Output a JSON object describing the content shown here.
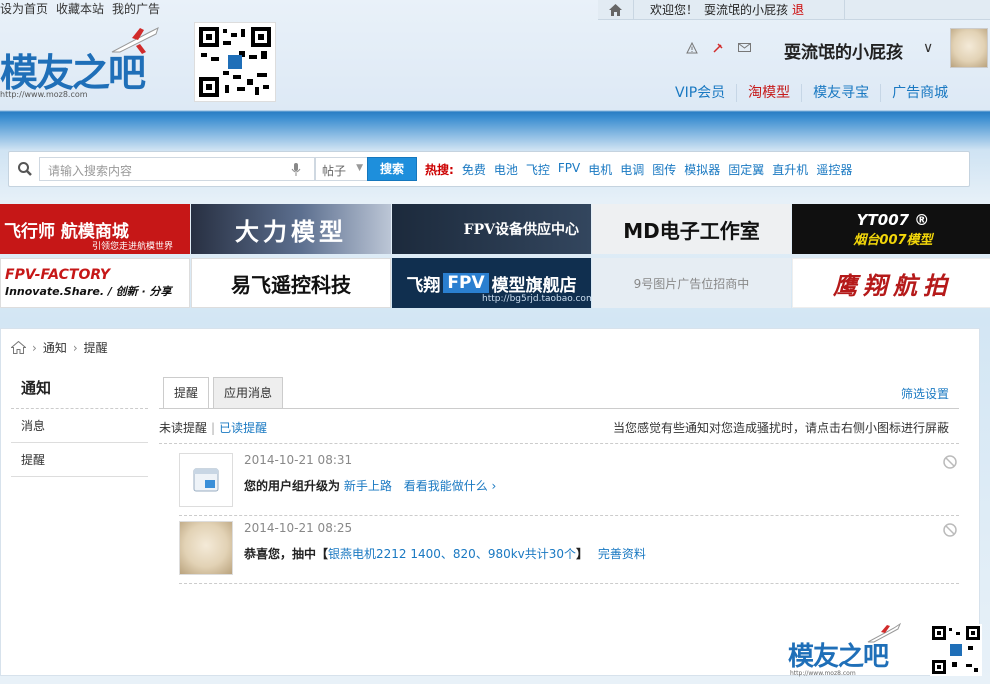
{
  "top_links": [
    "设为首页",
    "收藏本站",
    "我的广告"
  ],
  "userbar": {
    "welcome": "欢迎您！",
    "username": "耍流氓的小屁孩",
    "logout": "退"
  },
  "logo": {
    "text": "模友之吧",
    "url": "http://www.moz8.com"
  },
  "user_area": {
    "name": "耍流氓的小屁孩"
  },
  "topnav": [
    "VIP会员",
    "淘模型",
    "模友寻宝",
    "广告商城"
  ],
  "search": {
    "placeholder": "请输入搜索内容",
    "type": "帖子",
    "button": "搜索",
    "hot_label": "热搜:",
    "hot": [
      "免费",
      "电池",
      "飞控",
      "FPV",
      "电机",
      "电调",
      "图传",
      "模拟器",
      "固定翼",
      "直升机",
      "遥控器"
    ]
  },
  "ads": {
    "a1": "飞行师 航模商城",
    "a1_sub": "引领您走进航模世界",
    "a2": "大力模型",
    "a3": "FPV设备供应中心",
    "a4": "MD电子工作室",
    "a5_top": "YT007 ®",
    "a5_bottom": "烟台007模型",
    "a6_top": "FPV-FACTORY",
    "a6_bottom": "Innovate.Share. / 创新 · 分享",
    "a7": "易飞遥控科技",
    "a8_pre": "飞翔",
    "a8_fpv": "FPV",
    "a8_post": "模型旗舰店",
    "a8_url": "http://bg5rjd.taobao.com",
    "a9": "9号图片广告位招商中",
    "a10": "鹰翔航拍"
  },
  "breadcrumb": [
    "通知",
    "提醒"
  ],
  "sidebar": {
    "title": "通知",
    "items": [
      "消息",
      "提醒"
    ]
  },
  "tabs": [
    "提醒",
    "应用消息"
  ],
  "filter": "筛选设置",
  "subbar": {
    "unread": "未读提醒",
    "read": "已读提醒",
    "hint": "当您感觉有些通知对您造成骚扰时，请点击右侧小图标进行屏蔽"
  },
  "notifications": [
    {
      "time": "2014-10-21 08:31",
      "text": "您的用户组升级为",
      "link1": "新手上路",
      "link2": "看看我能做什么 ›"
    },
    {
      "time": "2014-10-21 08:25",
      "text_pre": "恭喜您，抽中【",
      "link1": "银燕电机2212 1400、820、980kv共计30个",
      "text_post": "】",
      "link2": "完善资料"
    }
  ],
  "colors": {
    "accent": "#1a79c2",
    "red": "#c61b1b",
    "search_button": "#1e8fdc"
  }
}
